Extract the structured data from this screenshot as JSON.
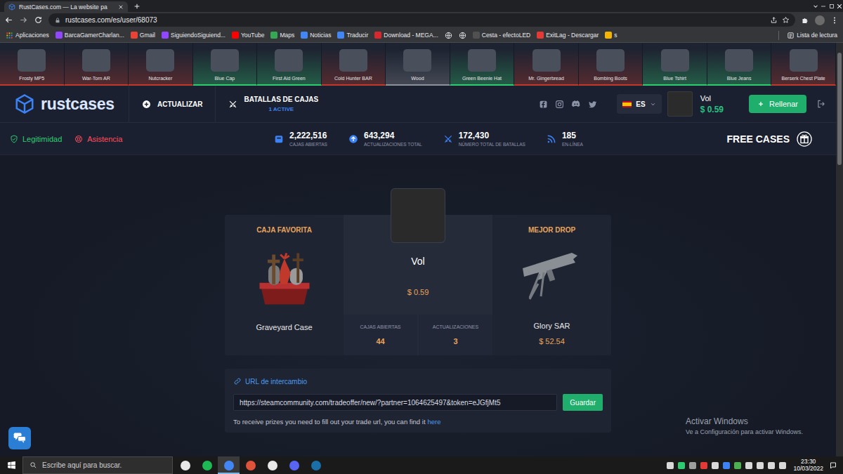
{
  "browser": {
    "tab": {
      "title": "RustCases.com — La website pa",
      "selected": true
    },
    "address": "rustcases.com/es/user/68073",
    "bookmarks": [
      {
        "label": "Aplicaciones",
        "kind": "apps",
        "color": "#4285f4"
      },
      {
        "label": "BarcaGamerCharlan...",
        "kind": "link",
        "color": "#9146ff"
      },
      {
        "label": "Gmail",
        "kind": "link",
        "color": "#ea4335"
      },
      {
        "label": "SiguiendoSiguiend...",
        "kind": "link",
        "color": "#9146ff"
      },
      {
        "label": "YouTube",
        "kind": "link",
        "color": "#ff0000"
      },
      {
        "label": "Maps",
        "kind": "link",
        "color": "#34a853"
      },
      {
        "label": "Noticias",
        "kind": "link",
        "color": "#4285f4"
      },
      {
        "label": "Traducir",
        "kind": "link",
        "color": "#4285f4"
      },
      {
        "label": "Download - MEGA...",
        "kind": "link",
        "color": "#d9272e"
      },
      {
        "kind": "icon",
        "color": "#e8eaed"
      },
      {
        "kind": "icon",
        "color": "#e8eaed"
      },
      {
        "label": "Cesta - efectoLED",
        "kind": "link",
        "color": "#505050"
      },
      {
        "label": "ExitLag - Descargar",
        "kind": "link",
        "color": "#e53935"
      },
      {
        "label": "s",
        "kind": "link",
        "color": "#f4b400"
      }
    ],
    "reading_list": "Lista de lectura"
  },
  "ticker": [
    {
      "name": "Frosty MP5",
      "color": "#c0392b"
    },
    {
      "name": "War-Torn AR",
      "color": "#c0392b"
    },
    {
      "name": "Nutcracker",
      "color": "#c0392b"
    },
    {
      "name": "Blue Cap",
      "color": "#2ecc71"
    },
    {
      "name": "First Aid Green",
      "color": "#2ecc71"
    },
    {
      "name": "Cold Hunter BAR",
      "color": "#c0392b"
    },
    {
      "name": "Wood",
      "color": "#8c9099"
    },
    {
      "name": "Green Beenie Hat",
      "color": "#2ecc71"
    },
    {
      "name": "Mr. Gingerbread",
      "color": "#c0392b"
    },
    {
      "name": "Bombing Boots",
      "color": "#c0392b"
    },
    {
      "name": "Blue Tshirt",
      "color": "#2ecc71"
    },
    {
      "name": "Blue Jeans",
      "color": "#2ecc71"
    },
    {
      "name": "Berserk Chest Plate",
      "color": "#c0392b"
    }
  ],
  "nav": {
    "logo": "rustcases",
    "links": [
      {
        "label": "ACTUALIZAR",
        "selected": false
      },
      {
        "label": "BATALLAS DE CAJAS",
        "badge": "1 ACTIVE",
        "selected": false
      }
    ],
    "language": "ES",
    "user": {
      "name": "Vol",
      "balance": "$ 0.59"
    },
    "refill_button": "Rellenar"
  },
  "stats_bar": {
    "legitimacy": "Legitimidad",
    "support": "Asistencia",
    "stats": [
      {
        "value": "2,222,516",
        "label": "CAJAS ABIERTAS"
      },
      {
        "value": "643,294",
        "label": "ACTUALIZACIONES TOTAL"
      },
      {
        "value": "172,430",
        "label": "NÚMERO TOTAL DE BATALLAS"
      },
      {
        "value": "185",
        "label": "EN-LÍNEA"
      }
    ],
    "free_cases": "FREE CASES"
  },
  "profile": {
    "favorite_case": {
      "title": "CAJA FAVORITA",
      "name": "Graveyard Case"
    },
    "user": {
      "name": "Vol",
      "balance": "$ 0.59"
    },
    "counters": [
      {
        "label": "CAJAS ABIERTAS",
        "value": "44"
      },
      {
        "label": "ACTUALIZACIONES",
        "value": "3"
      }
    ],
    "best_drop": {
      "title": "MEJOR DROP",
      "name": "Glory SAR",
      "price": "$ 52.54"
    }
  },
  "trade": {
    "title": "URL de intercambio",
    "url": "https://steamcommunity.com/tradeoffer/new/?partner=1064625497&token=eJGfjMt5",
    "button": "Guardar",
    "hint": "To receive prizes you need to fill out your trade url, you can find it",
    "link": "here"
  },
  "watermark": {
    "title": "Activar Windows",
    "subtitle": "Ve a Configuración para activar Windows."
  },
  "taskbar": {
    "search_placeholder": "Escribe aquí para buscar.",
    "apps": [
      {
        "color": "#e8e8e8",
        "selected": false
      },
      {
        "color": "#1db954",
        "selected": false
      },
      {
        "color": "#4285f4",
        "selected": true
      },
      {
        "color": "#e0533b",
        "selected": false
      },
      {
        "color": "#e8e8e8",
        "selected": false
      },
      {
        "color": "#5865f2",
        "selected": false
      },
      {
        "color": "#1b6fa8",
        "selected": false
      }
    ],
    "tray_icons": [
      {
        "color": "#d9d9d9"
      },
      {
        "color": "#2ecc71"
      },
      {
        "color": "#9e9e9e"
      },
      {
        "color": "#e53935"
      },
      {
        "color": "#d9d9d9"
      },
      {
        "color": "#3b82f6"
      },
      {
        "color": "#4caf50"
      },
      {
        "color": "#d9d9d9"
      },
      {
        "color": "#d9d9d9"
      },
      {
        "color": "#d9d9d9"
      },
      {
        "color": "#d9d9d9"
      }
    ],
    "time": "23:30",
    "date": "10/03/2022"
  }
}
